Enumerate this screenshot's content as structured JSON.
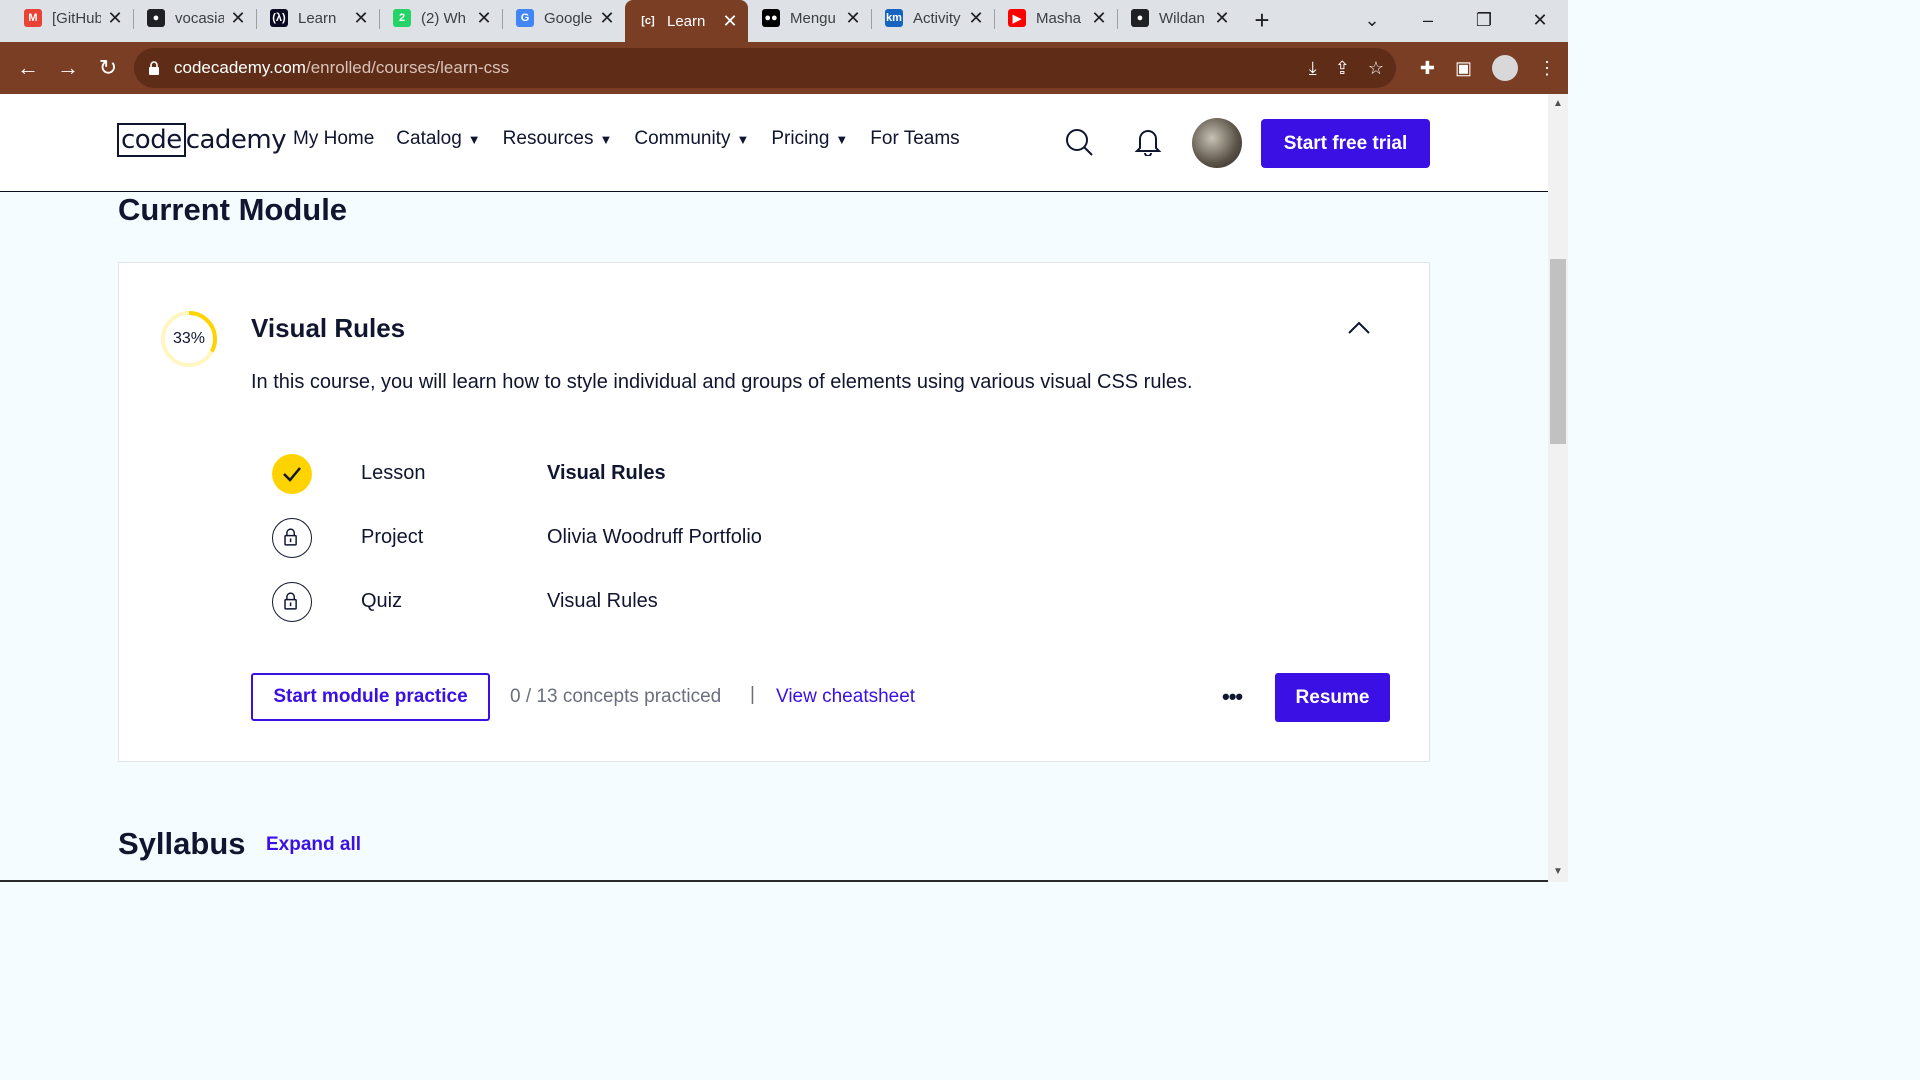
{
  "browser": {
    "tabs": [
      {
        "title": "[GitHub]",
        "icon": "gmail-icon",
        "color": "#ea4335",
        "glyph": "M"
      },
      {
        "title": "vocasia",
        "icon": "github-icon",
        "color": "#202124",
        "glyph": "●"
      },
      {
        "title": "Learn",
        "icon": "freecodecamp-icon",
        "color": "#0a0a23",
        "glyph": "(λ)"
      },
      {
        "title": "(2) Wh",
        "icon": "whatsapp-icon",
        "color": "#25d366",
        "glyph": "2"
      },
      {
        "title": "Google",
        "icon": "google-translate-icon",
        "color": "#4285f4",
        "glyph": "G"
      },
      {
        "title": "Learn",
        "icon": "codecademy-icon",
        "color": "#7a3e24",
        "glyph": "[c]"
      },
      {
        "title": "Mengu",
        "icon": "medium-icon",
        "color": "#000000",
        "glyph": "●●"
      },
      {
        "title": "Activity",
        "icon": "kampus-merdeka-icon",
        "color": "#1565c0",
        "glyph": "km"
      },
      {
        "title": "Masha",
        "icon": "youtube-icon",
        "color": "#ff0000",
        "glyph": "▶"
      },
      {
        "title": "Wildan",
        "icon": "github-icon",
        "color": "#202124",
        "glyph": "●"
      }
    ],
    "active_tab_index": 5,
    "url_host": "codecademy.com",
    "url_path": "/enrolled/courses/learn-css"
  },
  "site": {
    "logo_left": "code",
    "logo_right": "cademy",
    "nav": [
      {
        "label": "My Home",
        "caret": ""
      },
      {
        "label": "Catalog",
        "caret": "▼"
      },
      {
        "label": "Resources",
        "caret": "▼"
      },
      {
        "label": "Community",
        "caret": "▼"
      },
      {
        "label": "Pricing",
        "caret": "▼"
      },
      {
        "label": "For Teams",
        "caret": ""
      }
    ],
    "cta": "Start free trial"
  },
  "current_module": {
    "heading": "Current Module",
    "progress_label": "33%",
    "progress_fraction": 0.33,
    "title": "Visual Rules",
    "description": "In this course, you will learn how to style individual and groups of elements using various visual CSS rules.",
    "items": [
      {
        "kind": "Lesson",
        "name": "Visual Rules",
        "status": "complete"
      },
      {
        "kind": "Project",
        "name": "Olivia Woodruff Portfolio",
        "status": "locked"
      },
      {
        "kind": "Quiz",
        "name": "Visual Rules",
        "status": "locked"
      }
    ],
    "practice_button": "Start module practice",
    "concepts": "0 / 13 concepts practiced",
    "separator": "|",
    "cheatsheet": "View cheatsheet",
    "more": "•••",
    "resume": "Resume"
  },
  "syllabus": {
    "heading": "Syllabus",
    "expand": "Expand all"
  },
  "colors": {
    "brand_purple": "#3a10e5",
    "progress_yellow": "#ffd300",
    "text_navy": "#10162f",
    "browser_frame": "#7a3e24"
  }
}
